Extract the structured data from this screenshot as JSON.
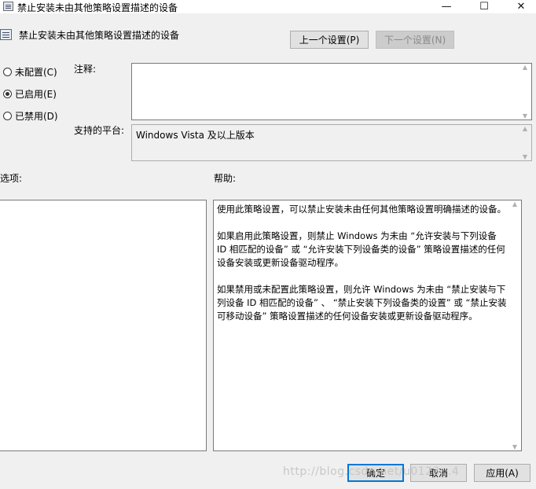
{
  "window": {
    "title": "禁止安装未由其他策略设置描述的设备",
    "title_icon": "policy-doc-icon",
    "minimize_glyph": "—",
    "maximize_glyph": "☐",
    "close_glyph": "✕"
  },
  "header": {
    "setting_name": "禁止安装未由其他策略设置描述的设备",
    "prev_label": "上一个设置(P)",
    "next_label": "下一个设置(N)"
  },
  "state": {
    "options": [
      {
        "label": "未配置(C)",
        "checked": false
      },
      {
        "label": "已启用(E)",
        "checked": true
      },
      {
        "label": "已禁用(D)",
        "checked": false
      }
    ]
  },
  "comment": {
    "label": "注释:",
    "value": ""
  },
  "platform": {
    "label": "支持的平台:",
    "value": "Windows Vista 及以上版本"
  },
  "options_panel": {
    "label": "选项:"
  },
  "help": {
    "label": "帮助:",
    "paragraphs": [
      "使用此策略设置，可以禁止安装未由任何其他策略设置明确描述的设备。",
      "如果启用此策略设置，则禁止 Windows 为未由 “允许安装与下列设备 ID 相匹配的设备” 或 “允许安装下列设备类的设备” 策略设置描述的任何设备安装或更新设备驱动程序。",
      "如果禁用或未配置此策略设置，则允许 Windows 为未由 “禁止安装与下列设备 ID 相匹配的设备” 、 “禁止安装下列设备类的设置” 或 “禁止安装可移动设备” 策略设置描述的任何设备安装或更新设备驱动程序。"
    ]
  },
  "footer": {
    "ok_label": "确定",
    "cancel_label": "取消",
    "apply_label": "应用(A)"
  },
  "watermark": "http://blog.csdn.net/u0123...4"
}
